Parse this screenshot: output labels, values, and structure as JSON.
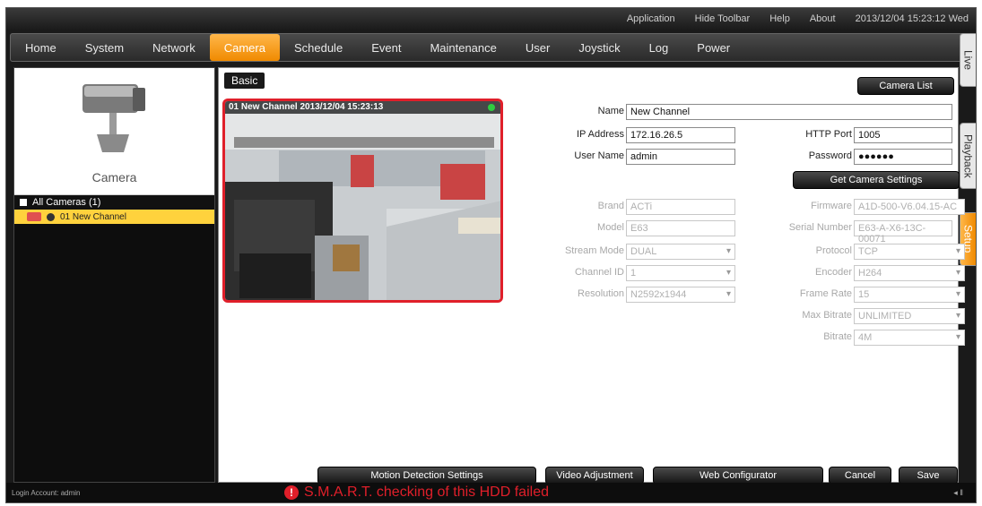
{
  "topbar": {
    "links": [
      "Application",
      "Hide Toolbar",
      "Help",
      "About"
    ],
    "datetime": "2013/12/04 15:23:12 Wed"
  },
  "menu": {
    "items": [
      "Home",
      "System",
      "Network",
      "Camera",
      "Schedule",
      "Event",
      "Maintenance",
      "User",
      "Joystick",
      "Log",
      "Power"
    ],
    "active": "Camera"
  },
  "sidetabs": [
    "Live",
    "Playback",
    "Setup"
  ],
  "left": {
    "camera_label": "Camera",
    "tree_root": "All Cameras (1)",
    "tree_item": "01  New Channel"
  },
  "content": {
    "tab": "Basic",
    "camera_list_btn": "Camera List",
    "preview_title": "01 New Channel  2013/12/04 15:23:13",
    "fields": {
      "name": {
        "label": "Name",
        "value": "New Channel"
      },
      "ip": {
        "label": "IP Address",
        "value": "172.16.26.5"
      },
      "http_port": {
        "label": "HTTP Port",
        "value": "1005"
      },
      "user": {
        "label": "User Name",
        "value": "admin"
      },
      "password": {
        "label": "Password",
        "value": "●●●●●●"
      }
    },
    "get_settings_btn": "Get Camera Settings",
    "disabled": {
      "brand": {
        "label": "Brand",
        "value": "ACTi"
      },
      "firmware": {
        "label": "Firmware",
        "value": "A1D-500-V6.04.15-AC"
      },
      "model": {
        "label": "Model",
        "value": "E63"
      },
      "serial": {
        "label": "Serial Number",
        "value": "E63-A-X6-13C-00071"
      },
      "stream_mode": {
        "label": "Stream Mode",
        "value": "DUAL"
      },
      "protocol": {
        "label": "Protocol",
        "value": "TCP"
      },
      "channel_id": {
        "label": "Channel ID",
        "value": "1"
      },
      "encoder": {
        "label": "Encoder",
        "value": "H264"
      },
      "resolution": {
        "label": "Resolution",
        "value": "N2592x1944"
      },
      "frame_rate": {
        "label": "Frame Rate",
        "value": "15"
      },
      "max_bitrate": {
        "label": "Max Bitrate",
        "value": "UNLIMITED"
      },
      "bitrate": {
        "label": "Bitrate",
        "value": "4M"
      }
    },
    "buttons": {
      "motion": "Motion Detection Settings",
      "video": "Video Adjustment",
      "web": "Web Configurator",
      "cancel": "Cancel",
      "save": "Save"
    }
  },
  "status": {
    "login": "Login Account: admin",
    "alert": "S.M.A.R.T. checking of this HDD failed",
    "icon_text": "!"
  },
  "colors": {
    "accent": "#f08a00",
    "alert": "#e01f2a",
    "selected_item": "#ffd23d"
  }
}
